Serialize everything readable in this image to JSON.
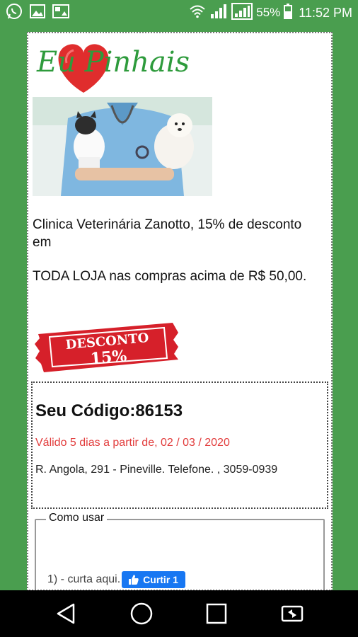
{
  "status_bar": {
    "battery_percent": "55%",
    "time": "11:52 PM",
    "left_icons": [
      "whatsapp-icon",
      "gallery-icon",
      "photo-icon"
    ],
    "right_icons": [
      "wifi-icon",
      "signal-icon",
      "signal-icon",
      "battery-icon"
    ]
  },
  "brand": {
    "logo_text": "Eu Pinhais",
    "logo_color": "#2e9b3c",
    "heart_color": "#e02d2d"
  },
  "offer": {
    "line1": "Clinica Veterinária Zanotto, 15% de desconto em",
    "line2": "TODA LOJA nas compras acima de R$ 50,00.",
    "stamp_word": "DESCONTO",
    "stamp_percent": "15%",
    "stamp_color": "#d6202a"
  },
  "coupon": {
    "code_label": "Seu Código:86153",
    "validity": "Válido 5 dias a partir de, 02 / 03 / 2020",
    "validity_color": "#e23c3c",
    "address": "R. Angola, 291 - Pineville. Telefone. , 3059-0939"
  },
  "how_to": {
    "legend": "Como usar",
    "step1_text": "1) - curta aqui.",
    "like_button": "Curtir 1",
    "like_color": "#1877f2"
  },
  "nav": {
    "buttons": [
      "back-icon",
      "home-icon",
      "recents-icon",
      "screen-rotate-icon"
    ]
  }
}
